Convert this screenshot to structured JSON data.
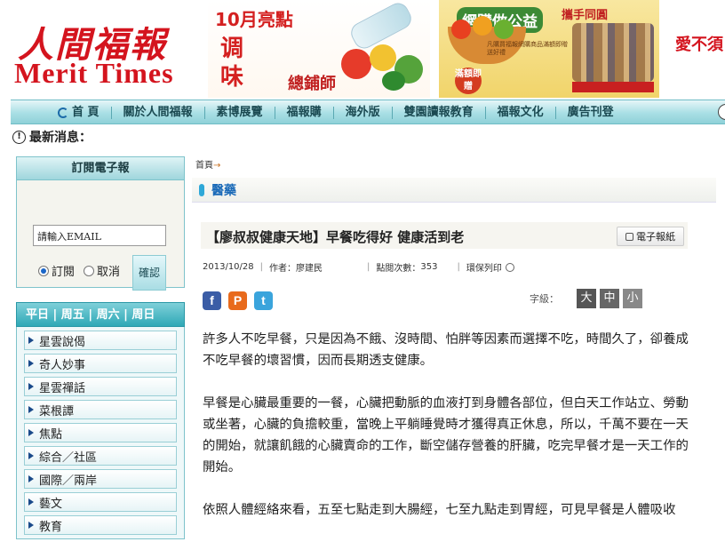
{
  "header": {
    "logo_cn": "人間福報",
    "logo_en": "Merit Times",
    "ad1": {
      "line1": "10月亮點",
      "line2": "调",
      "line3": "味",
      "line4": "總鋪師"
    },
    "ad2": {
      "line1": "網購做公益",
      "line2": "攜手同圓",
      "badge": "滿額即贈",
      "small": "凡購買福報網購商品滿額即贈送好禮"
    },
    "slogan": "愛不須"
  },
  "nav": {
    "items": [
      "首 頁",
      "關於人間福報",
      "素博展覽",
      "福報購",
      "海外版",
      "雙園讀報教育",
      "福報文化",
      "廣告刊登"
    ]
  },
  "news": {
    "label": "最新消息："
  },
  "sidebar": {
    "subscribe_title": "訂閱電子報",
    "email_value": "請輸入EMAIL",
    "radio_subscribe": "訂閱",
    "radio_cancel": "取消",
    "confirm": "確認",
    "days_title": "平日 | 周五 | 周六 | 周日",
    "items": [
      "星雲說偈",
      "奇人妙事",
      "星雲禪話",
      "菜根譚",
      "焦點",
      "綜合／社區",
      "國際／兩岸",
      "藝文",
      "教育"
    ]
  },
  "main": {
    "breadcrumb": "首頁",
    "section": "醫藥",
    "title": "【廖叔叔健康天地】早餐吃得好 健康活到老",
    "epaper": "電子報紙",
    "date": "2013/10/28",
    "author": "作者：廖建民",
    "views_label": "點閱次數：",
    "views": "353",
    "keep_print": "環保列印",
    "font_label": "字級：",
    "font_big": "大",
    "font_mid": "中",
    "font_small": "小",
    "paragraphs": [
      "許多人不吃早餐，只是因為不餓、沒時間、怕胖等因素而選擇不吃，時間久了，卻養成不吃早餐的壞習慣，因而長期透支健康。",
      "早餐是心臟最重要的一餐，心臟把動脈的血液打到身體各部位，但白天工作站立、勞動或坐著，心臟的負擔較重，當晚上平躺睡覺時才獲得真正休息，所以，千萬不要在一天的開始，就讓飢餓的心臟賣命的工作，斷空儲存營養的肝臟，吃完早餐才是一天工作的開始。",
      "依照人體經絡來看，五至七點走到大腸經，七至九點走到胃經，可見早餐是人體吸收"
    ]
  },
  "colors": {
    "brand_red": "#d4141e",
    "nav_teal": "#8fd1d8",
    "section_blue": "#1a6ab8"
  }
}
